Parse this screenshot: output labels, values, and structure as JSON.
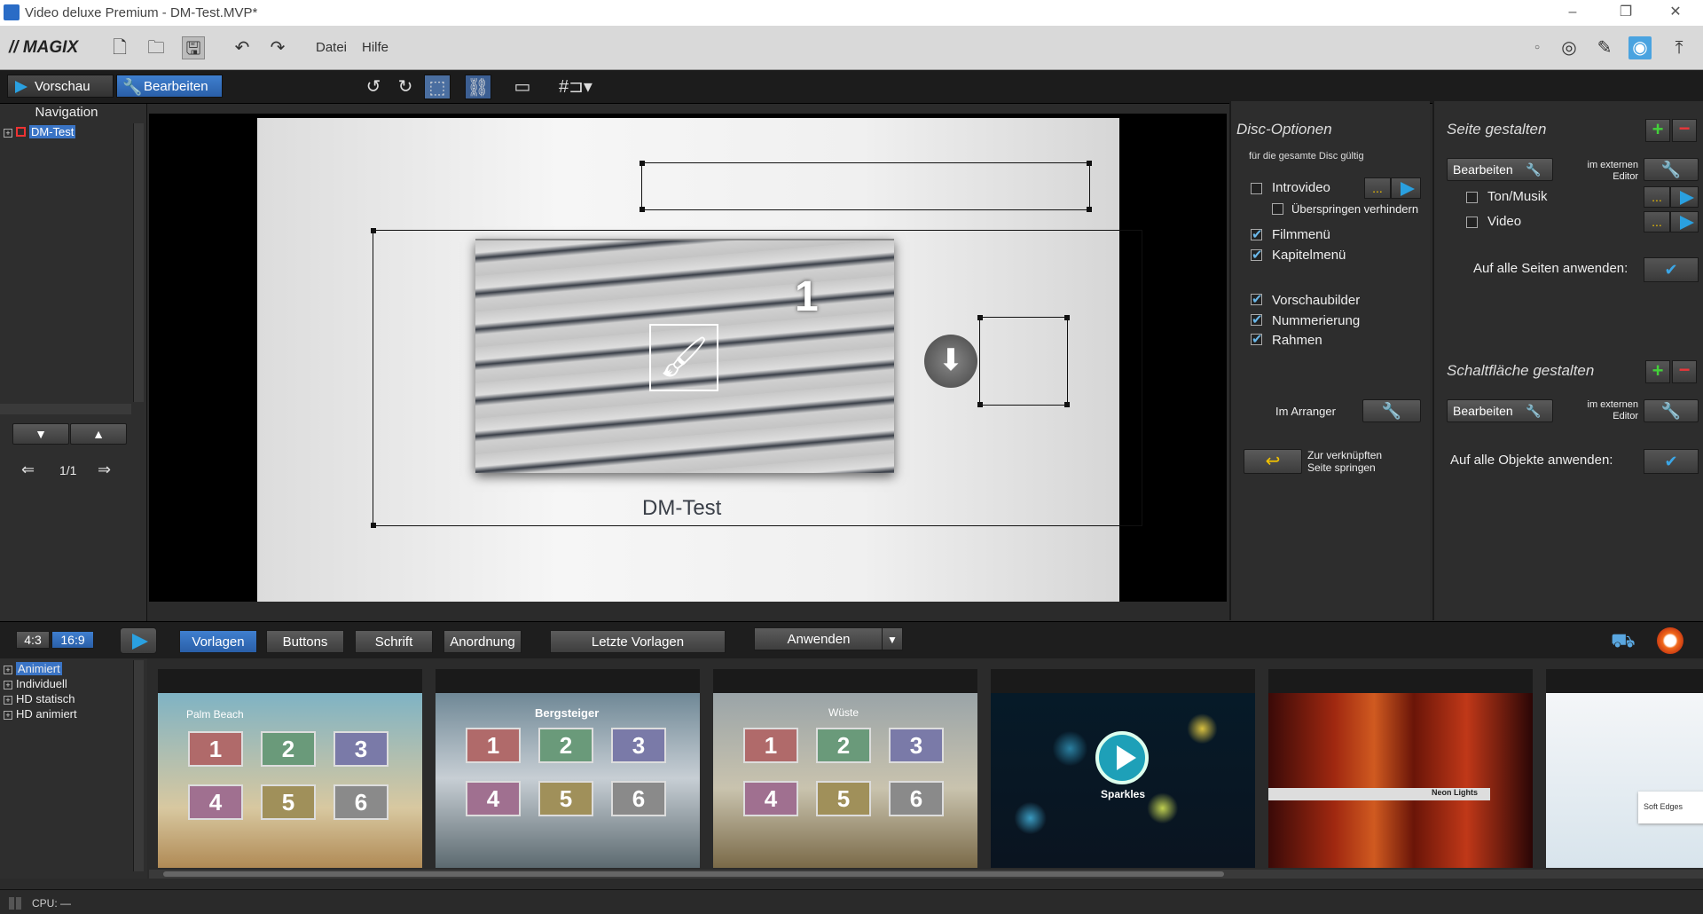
{
  "window": {
    "title": "Video deluxe Premium - DM-Test.MVP*",
    "minimize": "–",
    "restore": "❐",
    "close": "✕"
  },
  "menubar": {
    "brand": "// MAGIX",
    "menu": [
      "Datei",
      "Hilfe"
    ]
  },
  "toolbar2": {
    "preview_label": "Vorschau",
    "edit_label": "Bearbeiten"
  },
  "nav": {
    "title": "Navigation",
    "tree_item": "DM-Test",
    "page_counter": "1/1"
  },
  "canvas": {
    "chapter_number": "1",
    "menu_title": "DM-Test"
  },
  "disc": {
    "title": "Disc-Optionen",
    "subtitle": "für die gesamte Disc gültig",
    "introvideo": "Introvideo",
    "skip_forbid": "Überspringen verhindern",
    "filmmenu": "Filmmenü",
    "chaptermenu": "Kapitelmenü",
    "thumbnails": "Vorschaubilder",
    "numbering": "Nummerierung",
    "frame": "Rahmen",
    "in_arranger": "Im Arranger",
    "jump_linked_1": "Zur verknüpften",
    "jump_linked_2": "Seite springen",
    "dots": "..."
  },
  "seite": {
    "title": "Seite gestalten",
    "edit": "Bearbeiten",
    "ext_editor_1": "im externen",
    "ext_editor_2": "Editor",
    "sound": "Ton/Musik",
    "video": "Video",
    "apply_all_pages": "Auf alle Seiten anwenden:",
    "button_title": "Schaltfläche gestalten",
    "edit2": "Bearbeiten",
    "apply_all_objects": "Auf alle Objekte anwenden:"
  },
  "bottombar": {
    "ratio_43": "4:3",
    "ratio_169": "16:9",
    "tabs": [
      "Vorlagen",
      "Buttons",
      "Schrift",
      "Anordnung"
    ],
    "recent": "Letzte Vorlagen",
    "apply": "Anwenden"
  },
  "templates": {
    "tree": [
      "Animiert",
      "Individuell",
      "HD statisch",
      "HD animiert"
    ],
    "thumbs": [
      {
        "title": "Palm Beach"
      },
      {
        "title": "Bergsteiger"
      },
      {
        "title": "Wüste"
      },
      {
        "title": "Sparkles"
      },
      {
        "title": "Neon Lights"
      },
      {
        "title": "Soft Edges"
      }
    ],
    "numbers": [
      "1",
      "2",
      "3",
      "4",
      "5",
      "6"
    ]
  },
  "status": {
    "cpu": "CPU: —"
  },
  "colors": {
    "accent": "#2a6cc6",
    "green": "#43d13a",
    "red": "#e8373a",
    "blue_check": "#3ba6e6"
  }
}
